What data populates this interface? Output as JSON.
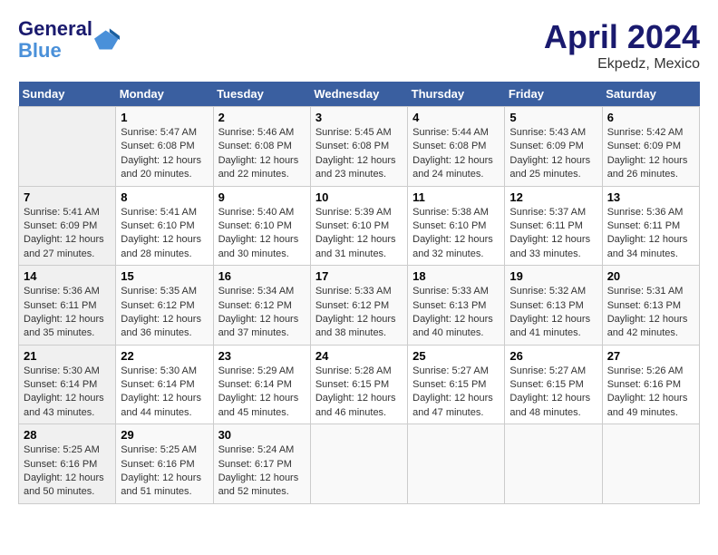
{
  "header": {
    "logo_line1": "General",
    "logo_line2": "Blue",
    "title": "April 2024",
    "subtitle": "Ekpedz, Mexico"
  },
  "columns": [
    "Sunday",
    "Monday",
    "Tuesday",
    "Wednesday",
    "Thursday",
    "Friday",
    "Saturday"
  ],
  "weeks": [
    [
      {
        "day": "",
        "info": ""
      },
      {
        "day": "1",
        "info": "Sunrise: 5:47 AM\nSunset: 6:08 PM\nDaylight: 12 hours\nand 20 minutes."
      },
      {
        "day": "2",
        "info": "Sunrise: 5:46 AM\nSunset: 6:08 PM\nDaylight: 12 hours\nand 22 minutes."
      },
      {
        "day": "3",
        "info": "Sunrise: 5:45 AM\nSunset: 6:08 PM\nDaylight: 12 hours\nand 23 minutes."
      },
      {
        "day": "4",
        "info": "Sunrise: 5:44 AM\nSunset: 6:08 PM\nDaylight: 12 hours\nand 24 minutes."
      },
      {
        "day": "5",
        "info": "Sunrise: 5:43 AM\nSunset: 6:09 PM\nDaylight: 12 hours\nand 25 minutes."
      },
      {
        "day": "6",
        "info": "Sunrise: 5:42 AM\nSunset: 6:09 PM\nDaylight: 12 hours\nand 26 minutes."
      }
    ],
    [
      {
        "day": "7",
        "info": "Sunrise: 5:41 AM\nSunset: 6:09 PM\nDaylight: 12 hours\nand 27 minutes."
      },
      {
        "day": "8",
        "info": "Sunrise: 5:41 AM\nSunset: 6:10 PM\nDaylight: 12 hours\nand 28 minutes."
      },
      {
        "day": "9",
        "info": "Sunrise: 5:40 AM\nSunset: 6:10 PM\nDaylight: 12 hours\nand 30 minutes."
      },
      {
        "day": "10",
        "info": "Sunrise: 5:39 AM\nSunset: 6:10 PM\nDaylight: 12 hours\nand 31 minutes."
      },
      {
        "day": "11",
        "info": "Sunrise: 5:38 AM\nSunset: 6:10 PM\nDaylight: 12 hours\nand 32 minutes."
      },
      {
        "day": "12",
        "info": "Sunrise: 5:37 AM\nSunset: 6:11 PM\nDaylight: 12 hours\nand 33 minutes."
      },
      {
        "day": "13",
        "info": "Sunrise: 5:36 AM\nSunset: 6:11 PM\nDaylight: 12 hours\nand 34 minutes."
      }
    ],
    [
      {
        "day": "14",
        "info": "Sunrise: 5:36 AM\nSunset: 6:11 PM\nDaylight: 12 hours\nand 35 minutes."
      },
      {
        "day": "15",
        "info": "Sunrise: 5:35 AM\nSunset: 6:12 PM\nDaylight: 12 hours\nand 36 minutes."
      },
      {
        "day": "16",
        "info": "Sunrise: 5:34 AM\nSunset: 6:12 PM\nDaylight: 12 hours\nand 37 minutes."
      },
      {
        "day": "17",
        "info": "Sunrise: 5:33 AM\nSunset: 6:12 PM\nDaylight: 12 hours\nand 38 minutes."
      },
      {
        "day": "18",
        "info": "Sunrise: 5:33 AM\nSunset: 6:13 PM\nDaylight: 12 hours\nand 40 minutes."
      },
      {
        "day": "19",
        "info": "Sunrise: 5:32 AM\nSunset: 6:13 PM\nDaylight: 12 hours\nand 41 minutes."
      },
      {
        "day": "20",
        "info": "Sunrise: 5:31 AM\nSunset: 6:13 PM\nDaylight: 12 hours\nand 42 minutes."
      }
    ],
    [
      {
        "day": "21",
        "info": "Sunrise: 5:30 AM\nSunset: 6:14 PM\nDaylight: 12 hours\nand 43 minutes."
      },
      {
        "day": "22",
        "info": "Sunrise: 5:30 AM\nSunset: 6:14 PM\nDaylight: 12 hours\nand 44 minutes."
      },
      {
        "day": "23",
        "info": "Sunrise: 5:29 AM\nSunset: 6:14 PM\nDaylight: 12 hours\nand 45 minutes."
      },
      {
        "day": "24",
        "info": "Sunrise: 5:28 AM\nSunset: 6:15 PM\nDaylight: 12 hours\nand 46 minutes."
      },
      {
        "day": "25",
        "info": "Sunrise: 5:27 AM\nSunset: 6:15 PM\nDaylight: 12 hours\nand 47 minutes."
      },
      {
        "day": "26",
        "info": "Sunrise: 5:27 AM\nSunset: 6:15 PM\nDaylight: 12 hours\nand 48 minutes."
      },
      {
        "day": "27",
        "info": "Sunrise: 5:26 AM\nSunset: 6:16 PM\nDaylight: 12 hours\nand 49 minutes."
      }
    ],
    [
      {
        "day": "28",
        "info": "Sunrise: 5:25 AM\nSunset: 6:16 PM\nDaylight: 12 hours\nand 50 minutes."
      },
      {
        "day": "29",
        "info": "Sunrise: 5:25 AM\nSunset: 6:16 PM\nDaylight: 12 hours\nand 51 minutes."
      },
      {
        "day": "30",
        "info": "Sunrise: 5:24 AM\nSunset: 6:17 PM\nDaylight: 12 hours\nand 52 minutes."
      },
      {
        "day": "",
        "info": ""
      },
      {
        "day": "",
        "info": ""
      },
      {
        "day": "",
        "info": ""
      },
      {
        "day": "",
        "info": ""
      }
    ]
  ]
}
